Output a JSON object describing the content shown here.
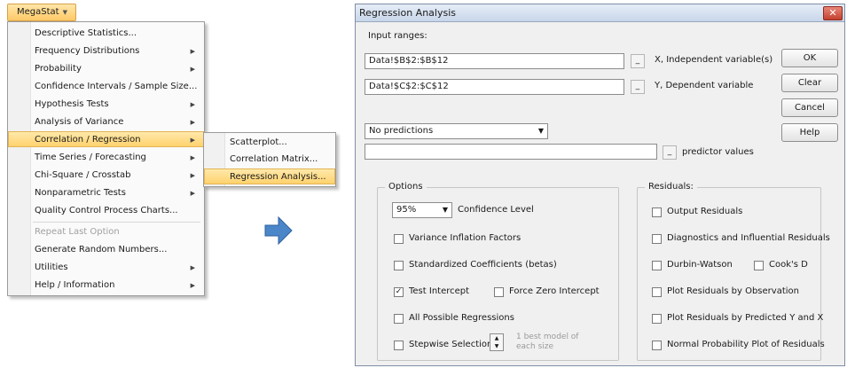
{
  "ribbon": {
    "megastat_label": "MegaStat"
  },
  "menu": {
    "items": [
      {
        "label": "Descriptive Statistics...",
        "has_submenu": false
      },
      {
        "label": "Frequency Distributions",
        "has_submenu": true
      },
      {
        "label": "Probability",
        "has_submenu": true
      },
      {
        "label": "Confidence Intervals / Sample Size...",
        "has_submenu": false
      },
      {
        "label": "Hypothesis Tests",
        "has_submenu": true
      },
      {
        "label": "Analysis of Variance",
        "has_submenu": true
      },
      {
        "label": "Correlation / Regression",
        "has_submenu": true,
        "highlighted": true
      },
      {
        "label": "Time Series / Forecasting",
        "has_submenu": true
      },
      {
        "label": "Chi-Square / Crosstab",
        "has_submenu": true
      },
      {
        "label": "Nonparametric Tests",
        "has_submenu": true
      },
      {
        "label": "Quality Control Process Charts...",
        "has_submenu": false
      },
      {
        "label": "Repeat Last Option",
        "disabled": true
      },
      {
        "label": "Generate Random Numbers...",
        "has_submenu": false
      },
      {
        "label": "Utilities",
        "has_submenu": true
      },
      {
        "label": "Help / Information",
        "has_submenu": true
      }
    ],
    "submenu": [
      {
        "label": "Scatterplot..."
      },
      {
        "label": "Correlation Matrix..."
      },
      {
        "label": "Regression Analysis...",
        "highlighted": true
      }
    ]
  },
  "dialog": {
    "title": "Regression Analysis",
    "close_glyph": "✕",
    "input_ranges_label": "Input ranges:",
    "x_range_value": "Data!$B$2:$B$12",
    "x_label": "X, Independent variable(s)",
    "y_range_value": "Data!$C$2:$C$12",
    "y_label": "Y, Dependent variable",
    "predictions_select": "No predictions",
    "predictor_values_input": "",
    "predictor_values_label": "predictor values",
    "buttons": {
      "ok": "OK",
      "clear": "Clear",
      "cancel": "Cancel",
      "help": "Help"
    },
    "options": {
      "title": "Options",
      "confidence_value": "95%",
      "confidence_label": "Confidence Level",
      "vif": "Variance Inflation Factors",
      "std_coeff": "Standardized Coefficients (betas)",
      "test_intercept": "Test Intercept",
      "test_intercept_checked": true,
      "force_zero": "Force Zero Intercept",
      "all_possible": "All Possible Regressions",
      "stepwise": "Stepwise Selection",
      "stepwise_note_1": "1 best model of",
      "stepwise_note_2": "each size"
    },
    "residuals": {
      "title": "Residuals:",
      "output": "Output Residuals",
      "diagnostics": "Diagnostics and Influential Residuals",
      "durbin": "Durbin-Watson",
      "cooks": "Cook's D",
      "plot_obs": "Plot Residuals by Observation",
      "plot_pred": "Plot Residuals by Predicted Y and X",
      "normal_plot": "Normal Probability Plot of Residuals"
    },
    "accent": "#4a86c8"
  }
}
